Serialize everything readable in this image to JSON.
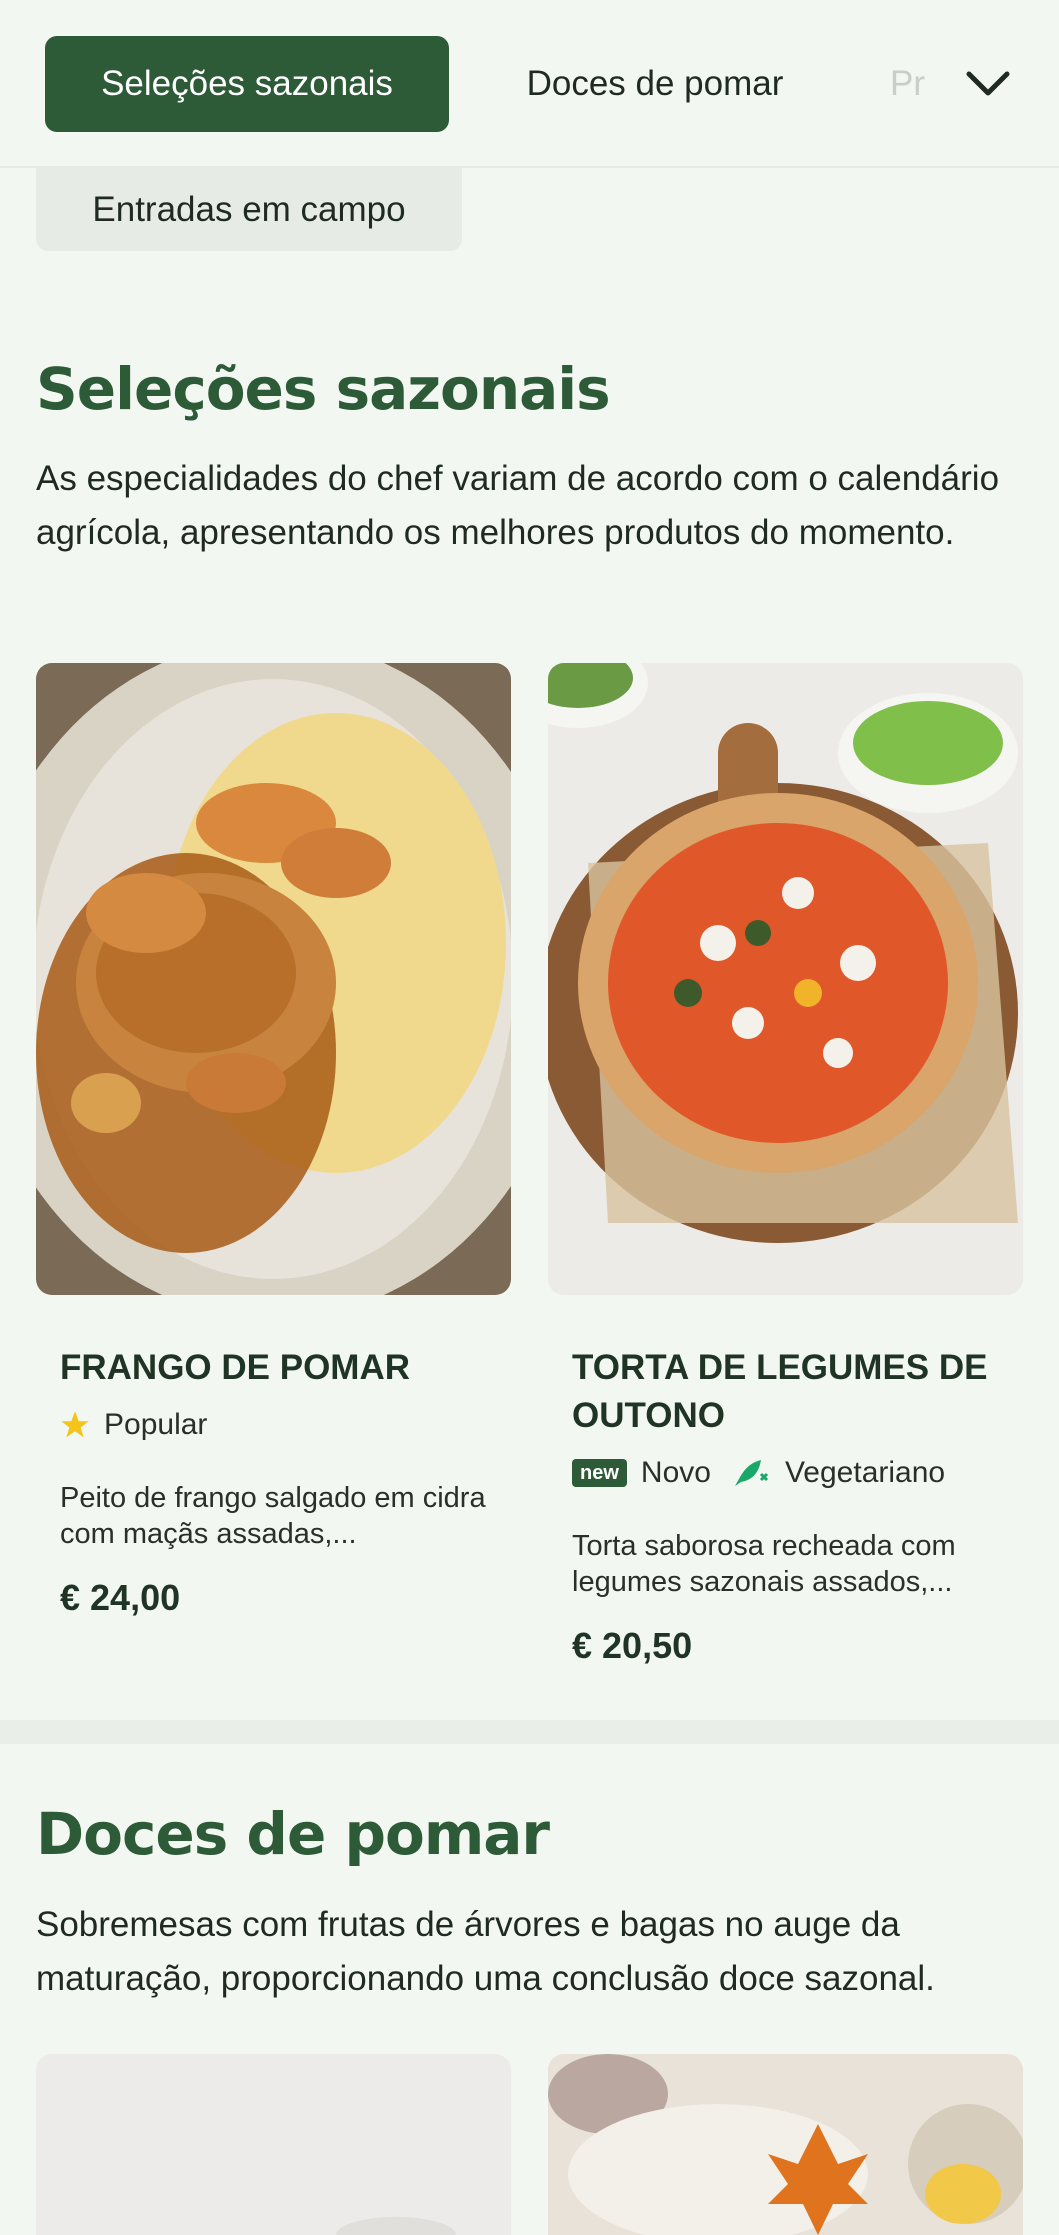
{
  "nav": {
    "tabs": [
      {
        "label": "Seleções sazonais"
      },
      {
        "label": "Doces de pomar"
      },
      {
        "label": "Pr"
      }
    ],
    "second_row_tab": "Entradas em campo"
  },
  "sections": [
    {
      "title": "Seleções sazonais",
      "description": "As especialidades do chef variam de acordo com o calendário agrícola, apresentando os melhores produtos do momento.",
      "items": [
        {
          "name": "FRANGO DE POMAR",
          "badges": [
            {
              "icon": "star-icon",
              "label": "Popular"
            }
          ],
          "description": "Peito de frango salgado em cidra com maçãs assadas,...",
          "price": "€ 24,00"
        },
        {
          "name": "TORTA DE LEGUMES DE OUTONO",
          "badges": [
            {
              "icon": "new-badge",
              "icon_text": "new",
              "label": "Novo"
            },
            {
              "icon": "leaf-icon",
              "label": "Vegetariano"
            }
          ],
          "description": "Torta saborosa recheada com legumes sazonais assados,...",
          "price": "€ 20,50"
        }
      ]
    },
    {
      "title": "Doces de pomar",
      "description": "Sobremesas com frutas de árvores e bagas no auge da maturação, proporcionando uma conclusão doce sazonal."
    }
  ],
  "colors": {
    "brand": "#2d5a37",
    "background": "#f3f7f2",
    "star": "#f3c41a",
    "vegetarian": "#1aa86a"
  }
}
